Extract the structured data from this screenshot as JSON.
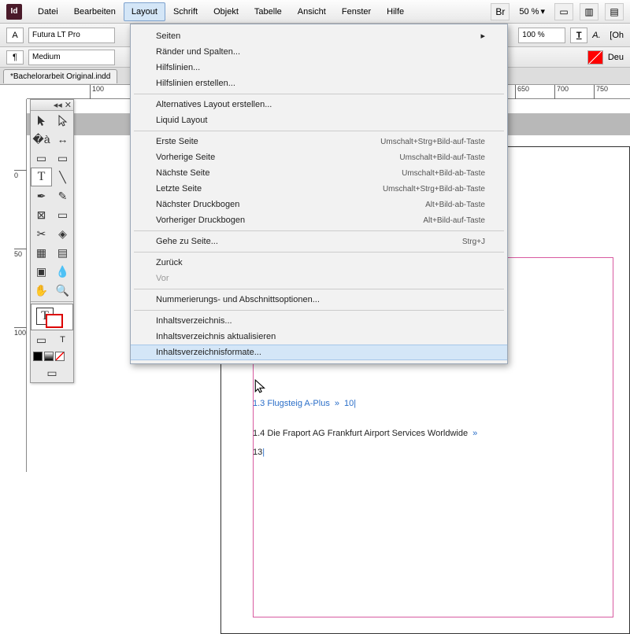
{
  "menubar": {
    "items": [
      "Datei",
      "Bearbeiten",
      "Layout",
      "Schrift",
      "Objekt",
      "Tabelle",
      "Ansicht",
      "Fenster",
      "Hilfe"
    ],
    "active_index": 2,
    "zoom": "50 %",
    "br_label": "Br"
  },
  "toolbar": {
    "font_family": "Futura LT Pro",
    "font_weight": "Medium",
    "percent": "100 %",
    "right_label": "[Oh",
    "secondary_right": "Deu"
  },
  "tab": {
    "label": "*Bachelorarbeit Original.indd"
  },
  "ruler_h": [
    "100",
    "650",
    "700",
    "750"
  ],
  "ruler_v": [
    "0",
    "50",
    "100"
  ],
  "dropdown": {
    "items": [
      {
        "label": "Seiten",
        "submenu": true
      },
      {
        "label": "Ränder und Spalten..."
      },
      {
        "label": "Hilfslinien..."
      },
      {
        "label": "Hilfslinien erstellen..."
      },
      {
        "sep": true
      },
      {
        "label": "Alternatives Layout erstellen..."
      },
      {
        "label": "Liquid Layout"
      },
      {
        "sep": true
      },
      {
        "label": "Erste Seite",
        "shortcut": "Umschalt+Strg+Bild-auf-Taste"
      },
      {
        "label": "Vorherige Seite",
        "shortcut": "Umschalt+Bild-auf-Taste"
      },
      {
        "label": "Nächste Seite",
        "shortcut": "Umschalt+Bild-ab-Taste"
      },
      {
        "label": "Letzte Seite",
        "shortcut": "Umschalt+Strg+Bild-ab-Taste"
      },
      {
        "label": "Nächster Druckbogen",
        "shortcut": "Alt+Bild-ab-Taste"
      },
      {
        "label": "Vorheriger Druckbogen",
        "shortcut": "Alt+Bild-auf-Taste"
      },
      {
        "sep": true
      },
      {
        "label": "Gehe zu Seite...",
        "shortcut": "Strg+J"
      },
      {
        "sep": true
      },
      {
        "label": "Zurück"
      },
      {
        "label": "Vor",
        "disabled": true
      },
      {
        "sep": true
      },
      {
        "label": "Nummerierungs- und Abschnittsoptionen..."
      },
      {
        "sep": true
      },
      {
        "label": "Inhaltsverzeichnis..."
      },
      {
        "label": "Inhaltsverzeichnis aktualisieren"
      },
      {
        "label": "Inhaltsverzeichnisformate...",
        "hover": true
      }
    ]
  },
  "page_content": {
    "line1_a": "1.3 Flugsteig A-Plus",
    "line1_b": "10",
    "line2_a": "1.4 Die Fraport AG Frankfurt Airport Services Worldwide",
    "line2_b": "13"
  },
  "app_icon": "Id"
}
